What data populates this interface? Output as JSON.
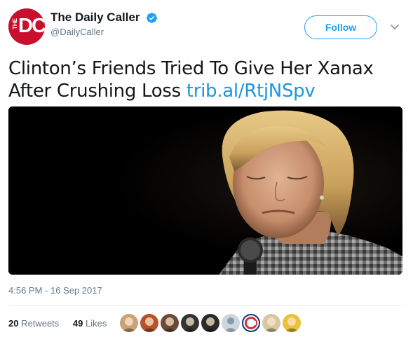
{
  "account": {
    "display_name": "The Daily Caller",
    "handle": "@DailyCaller",
    "avatar_text_small": "THE",
    "avatar_text_large": "DC",
    "avatar_color": "#c8102e",
    "verified": true
  },
  "actions": {
    "follow_label": "Follow"
  },
  "tweet": {
    "text": "Clinton’s Friends Tried To Give Her Xanax After Crushing Loss",
    "link": "trib.al/RtjNSpv",
    "timestamp": "4:56 PM - 16 Sep 2017"
  },
  "stats": {
    "retweets_count": "20",
    "retweets_label": "Retweets",
    "likes_count": "49",
    "likes_label": "Likes"
  },
  "likers": [
    {
      "icon": "profile-avatar",
      "color": "#c9a27a"
    },
    {
      "icon": "profile-avatar",
      "color": "#b5542c"
    },
    {
      "icon": "profile-avatar",
      "color": "#6b4a3a"
    },
    {
      "icon": "profile-avatar",
      "color": "#333333"
    },
    {
      "icon": "profile-avatar",
      "color": "#2a2a2a"
    },
    {
      "icon": "default-egg-avatar",
      "color": "#ccd6dd"
    },
    {
      "icon": "cubs-logo-avatar",
      "color": "#0e3386"
    },
    {
      "icon": "profile-avatar",
      "color": "#d6c8a4"
    },
    {
      "icon": "profile-avatar",
      "color": "#e8c23a"
    }
  ],
  "colors": {
    "link": "#1b95e0",
    "accent": "#1da1f2",
    "secondary_text": "#657786"
  }
}
